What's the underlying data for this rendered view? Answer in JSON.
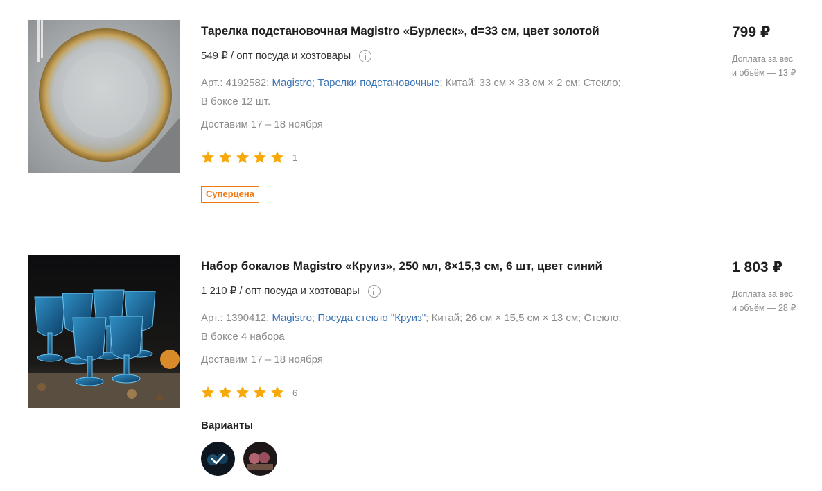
{
  "products": [
    {
      "title": "Тарелка подстановочная Magistro «Бурлеск», d=33 см, цвет золотой",
      "wholesale": "549 ₽ / опт посуда и хозтовары",
      "article": "Арт.: 4192582;",
      "brand": "Magistro",
      "sep1": ";",
      "category": "Тарелки подстановочные",
      "sep2": ";",
      "rest": "Китай; 33 см × 33 см × 2 см; Стекло;",
      "box": "В боксе 12 шт.",
      "delivery": "Доставим 17 – 18 ноября",
      "rating_count": "1",
      "rating_value": 5,
      "badge": "Суперцена",
      "price": "799 ₽",
      "surcharge_line1": "Доплата за вес",
      "surcharge_line2": "и объём — 13 ₽",
      "image_icon": "gold-rim-plate-image"
    },
    {
      "title": "Набор бокалов Magistro «Круиз», 250 мл, 8×15,3 см, 6 шт, цвет синий",
      "wholesale": "1 210 ₽ / опт посуда и хозтовары",
      "article": "Арт.: 1390412;",
      "brand": "Magistro",
      "sep1": ";",
      "category": "Посуда стекло \"Круиз\"",
      "sep2": ";",
      "rest": "Китай; 26 см × 15,5 см × 13 см; Стекло;",
      "box": "В боксе 4 набора",
      "delivery": "Доставим 17 – 18 ноября",
      "rating_count": "6",
      "rating_value": 5,
      "variants_title": "Варианты",
      "price": "1 803 ₽",
      "surcharge_line1": "Доплата за вес",
      "surcharge_line2": "и объём — 28 ₽",
      "image_icon": "blue-goblets-image"
    }
  ],
  "colors": {
    "link": "#3a73b5",
    "star": "#f7a90b",
    "badge": "#f07a13",
    "muted": "#8a8a8a"
  }
}
